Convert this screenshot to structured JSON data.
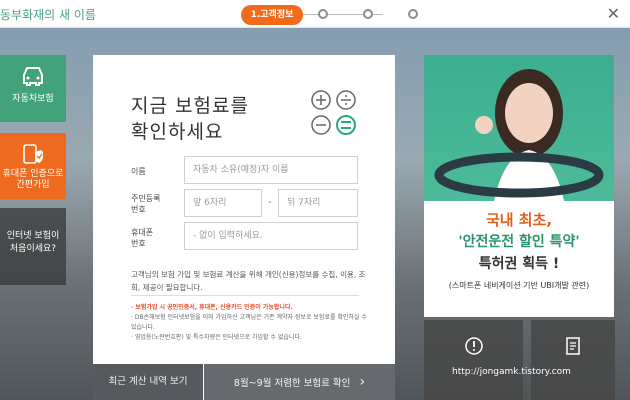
{
  "header": {
    "brand": "동부화재의 새 이름",
    "active_step": "1.고객정보"
  },
  "sidebar": {
    "items": [
      {
        "label": "자동차보험",
        "icon": "car-icon"
      },
      {
        "label": "휴대폰 인증으로\n간편가입",
        "icon": "shield-check-icon"
      },
      {
        "label": "인터넷 보험이\n처음이세요?"
      }
    ]
  },
  "card": {
    "title": "지금 보험료를\n확인하세요",
    "name_label": "이름",
    "name_placeholder": "자동차 소유(예정)자 이름",
    "rrn_label": "주민등록\n번호",
    "rrn_front_placeholder": "앞 6자리",
    "rrn_dash": "-",
    "rrn_back_placeholder": "뒤 7자리",
    "phone_label": "휴대폰\n번호",
    "phone_placeholder": "- 없이 입력하세요.",
    "notice": "고객님의 보험 가입 및 보험료 계산을 위해 개인(신용)정보를 수집, 이용, 조회, 제공이 필요합니다.",
    "bullets": [
      "보험가입 시 공인인증서, 휴대폰, 신용카드 인증이 가능합니다.",
      "DB손해보험 인터넷보험을 이미 가입하신 고객님은 기존 계약자 정보로 보험료를 확인하실 수 있습니다.",
      "영업용(노란번호판) 및 특수차량은 인터넷으로 가입할 수 없습니다."
    ],
    "btn_recent": "최근 계산 내역 보기",
    "btn_check": "8월~9월 저렴한 보험료 확인",
    "btn_check_arrow": "›"
  },
  "ad": {
    "line1": "국내 최초,",
    "line2": "'안전운전 할인 특약'",
    "line3": "특허권 획득 !",
    "line4": "(스마트폰 네비게이션 기반 UBI개발 관련)"
  },
  "watermark": "http://jongamk.tistory.com",
  "colors": {
    "accent_orange": "#f26a1b",
    "brand_green": "#42a37a"
  }
}
